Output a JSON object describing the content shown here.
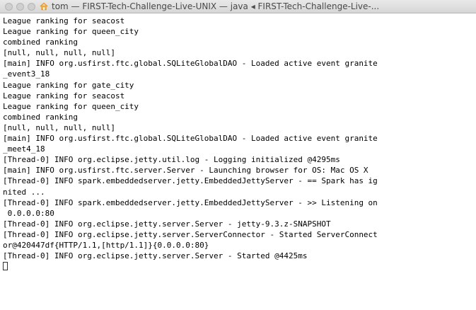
{
  "window": {
    "title": "tom — FIRST-Tech-Challenge-Live-UNIX — java ◂ FIRST-Tech-Challenge-Live-..."
  },
  "icons": {
    "home": "home-icon"
  },
  "terminal": {
    "lines": [
      "League ranking for seacost",
      "League ranking for queen_city",
      "combined ranking",
      "[null, null, null, null]",
      "[main] INFO org.usfirst.ftc.global.SQLiteGlobalDAO - Loaded active event granite",
      "_event3_18",
      "League ranking for gate_city",
      "League ranking for seacost",
      "League ranking for queen_city",
      "combined ranking",
      "[null, null, null, null]",
      "[main] INFO org.usfirst.ftc.global.SQLiteGlobalDAO - Loaded active event granite",
      "_meet4_18",
      "[Thread-0] INFO org.eclipse.jetty.util.log - Logging initialized @4295ms",
      "[main] INFO org.usfirst.ftc.server.Server - Launching browser for OS: Mac OS X",
      "[Thread-0] INFO spark.embeddedserver.jetty.EmbeddedJettyServer - == Spark has ig",
      "nited ...",
      "[Thread-0] INFO spark.embeddedserver.jetty.EmbeddedJettyServer - >> Listening on",
      " 0.0.0.0:80",
      "[Thread-0] INFO org.eclipse.jetty.server.Server - jetty-9.3.z-SNAPSHOT",
      "[Thread-0] INFO org.eclipse.jetty.server.ServerConnector - Started ServerConnect",
      "or@420447df{HTTP/1.1,[http/1.1]}{0.0.0.0:80}",
      "[Thread-0] INFO org.eclipse.jetty.server.Server - Started @4425ms"
    ]
  }
}
